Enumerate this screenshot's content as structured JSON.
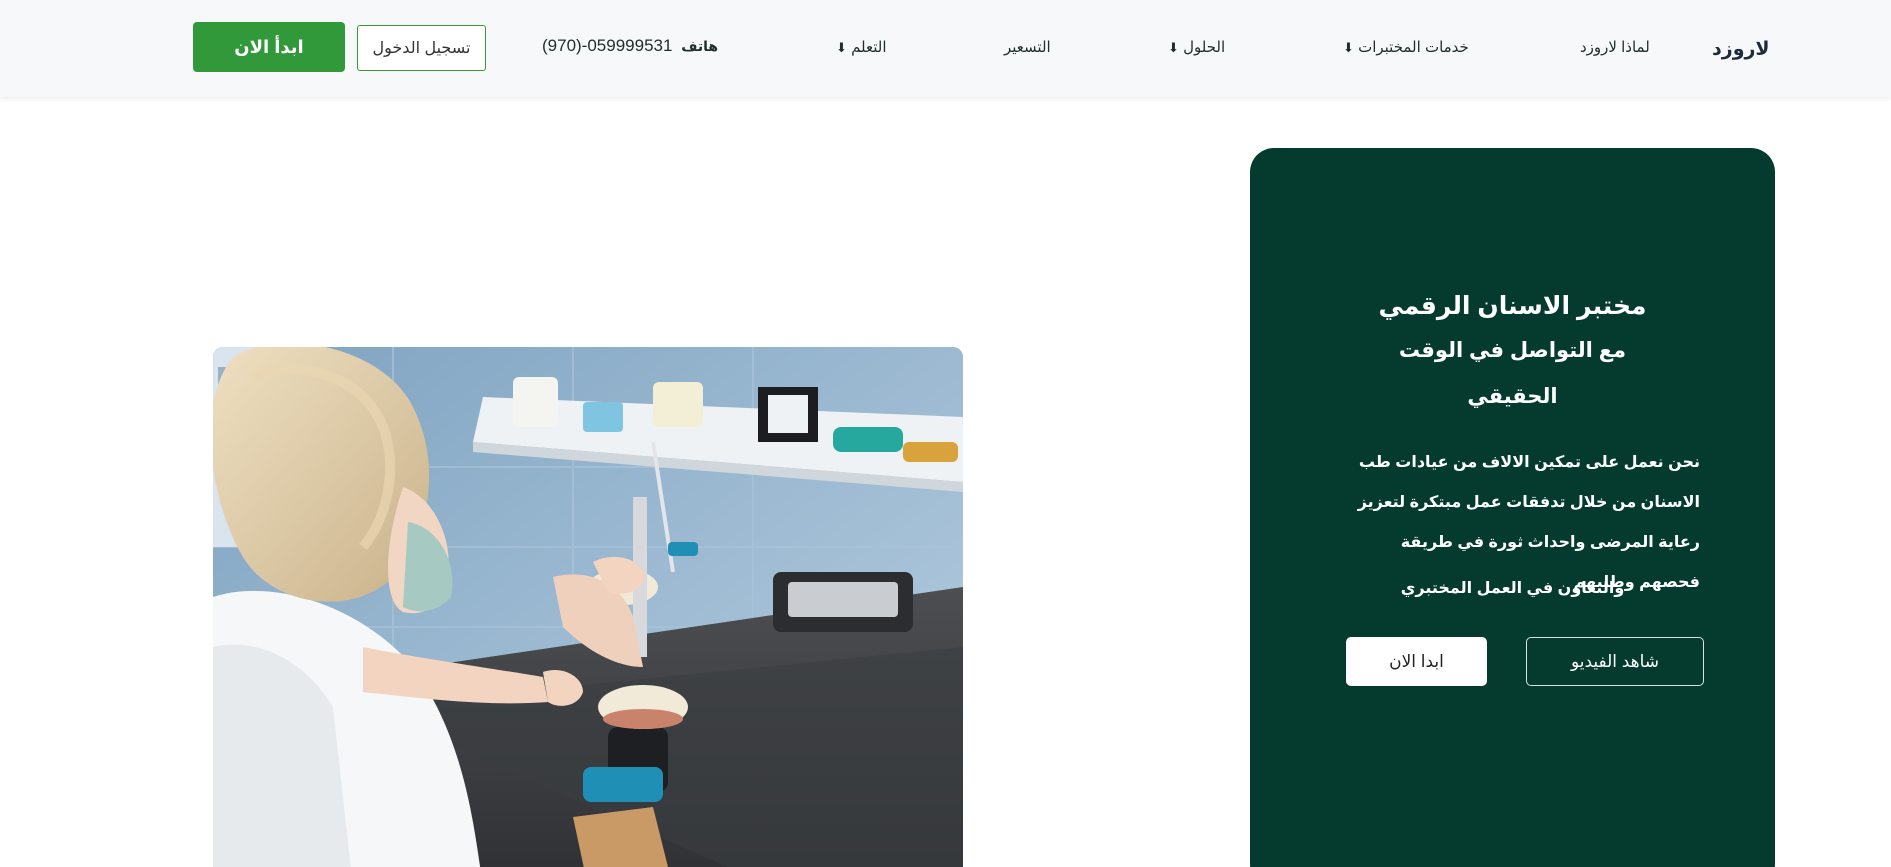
{
  "nav": {
    "brand": "لاروزد",
    "items": [
      {
        "label": "لماذا لاروزد",
        "has_dropdown": false
      },
      {
        "label": "خدمات المختبرات",
        "has_dropdown": true
      },
      {
        "label": "الحلول",
        "has_dropdown": true
      },
      {
        "label": "التسعير",
        "has_dropdown": false
      },
      {
        "label": "التعلم",
        "has_dropdown": true
      }
    ],
    "dropdown_arrow": "⬇",
    "phone_label": "هاتف",
    "phone_number": "(970)-059999531",
    "login_label": "تسجيل الدخول",
    "start_label": "ابدأ الان"
  },
  "hero": {
    "title": "مختبر الاسنان الرقمي",
    "subtitle_line1": "مع التواصل في الوقت",
    "subtitle_line2": "الحقيقي",
    "description": "نحن نعمل على تمكين الالاف من عيادات طب الاسنان من خلال تدفقات عمل مبتكرة لتعزيز رعاية المرضى واحداث ثورة في طريقة فحصهم وطلبهم",
    "description_line2": "والتعاون في العمل المختبري",
    "video_button": "شاهد الفيديو",
    "start_button": "ابدا الان"
  },
  "photo": {
    "alt_name": "dental-technician-photo"
  },
  "colors": {
    "brand_green": "#32993a",
    "hero_bg": "#053b2f",
    "nav_bg": "#f6f8f9"
  }
}
